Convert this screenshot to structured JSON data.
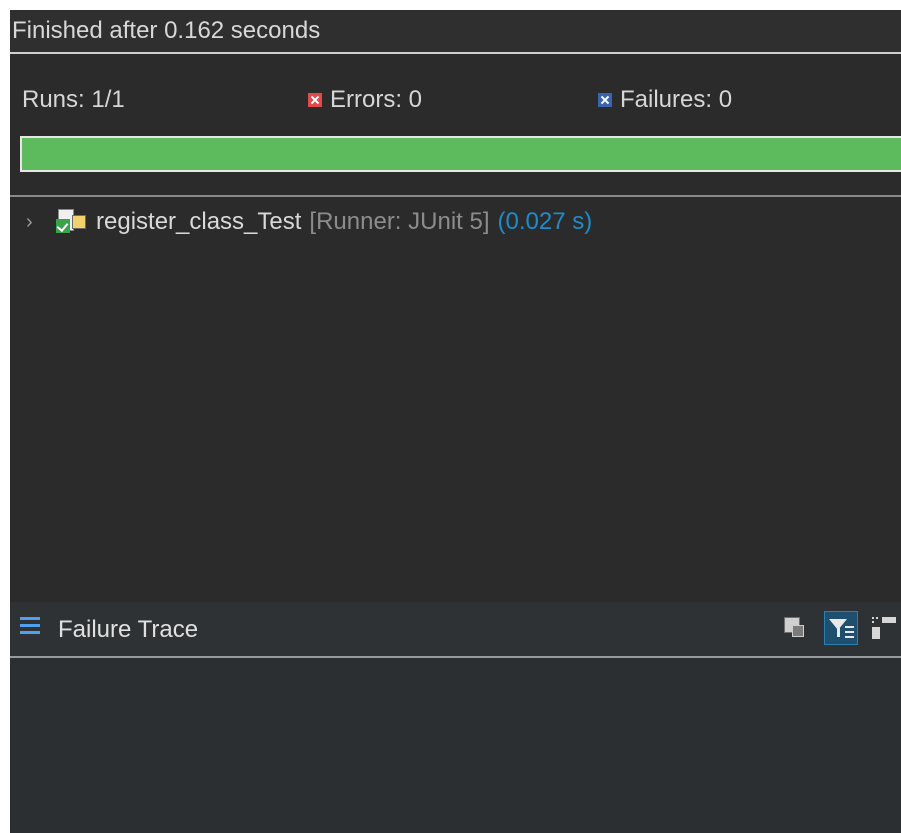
{
  "status": {
    "text": "Finished after 0.162 seconds"
  },
  "counters": {
    "runs": "Runs:  1/1",
    "errors": "Errors:  0",
    "failures": "Failures:  0"
  },
  "progress": {
    "fraction": 1.0,
    "color": "#5dbb5d",
    "state": "passed"
  },
  "tree": {
    "items": [
      {
        "name": "register_class_Test",
        "runner": "[Runner: JUnit 5]",
        "time": "(0.027 s)",
        "expanded": false,
        "icon": "test-suite-passed-icon"
      }
    ]
  },
  "trace": {
    "title": "Failure Trace",
    "icons": [
      "menu-icon",
      "compare-result-icon",
      "filter-stack-trace-icon",
      "layout-toggle-icon"
    ]
  },
  "colors": {
    "background": "#2b2b2b",
    "accent": "#1d8ccd",
    "error": "#e04a4a",
    "failure": "#3a63b0"
  }
}
